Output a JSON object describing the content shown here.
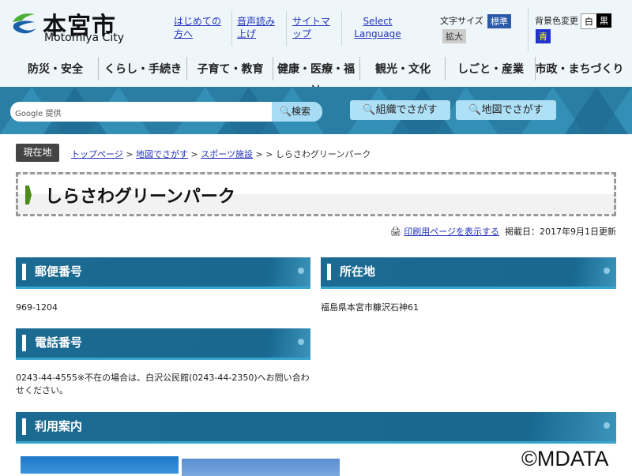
{
  "logo": {
    "jp": "本宮市",
    "en": "Motomiya City"
  },
  "header_links": [
    "はじめての方へ",
    "音声読み上げ",
    "サイトマップ",
    "Select Language"
  ],
  "text_size": {
    "label": "文字サイズ",
    "standard": "標準",
    "large": "拡大"
  },
  "bg_color": {
    "label": "背景色変更",
    "white": "白",
    "black": "黒",
    "blue": "青"
  },
  "nav": [
    "防災・安全",
    "くらし・手続き",
    "子育て・教育",
    "健康・医療・福祉",
    "観光・文化",
    "しごと・産業",
    "市政・まちづくり"
  ],
  "search": {
    "placeholder": "Google 提供",
    "button": "検索"
  },
  "search_buttons": [
    "組織でさがす",
    "地図でさがす"
  ],
  "breadcrumb": {
    "label": "現在地",
    "items": [
      "トップページ",
      "地図でさがす",
      "スポーツ施設"
    ],
    "current": "しらさわグリーンパーク"
  },
  "page_title": "しらさわグリーンパーク",
  "print_link": "印刷用ページを表示する",
  "published": "掲載日：2017年9月1日更新",
  "sections": {
    "postal": {
      "heading": "郵便番号",
      "body": "969-1204"
    },
    "address": {
      "heading": "所在地",
      "body": "福島県本宮市糠沢石神61"
    },
    "phone": {
      "heading": "電話番号",
      "body": "0243-44-4555※不在の場合は、白沢公民館(0243-44-2350)へお問い合わせください。"
    },
    "usage": {
      "heading": "利用案内"
    }
  },
  "watermark": "©MDATA"
}
